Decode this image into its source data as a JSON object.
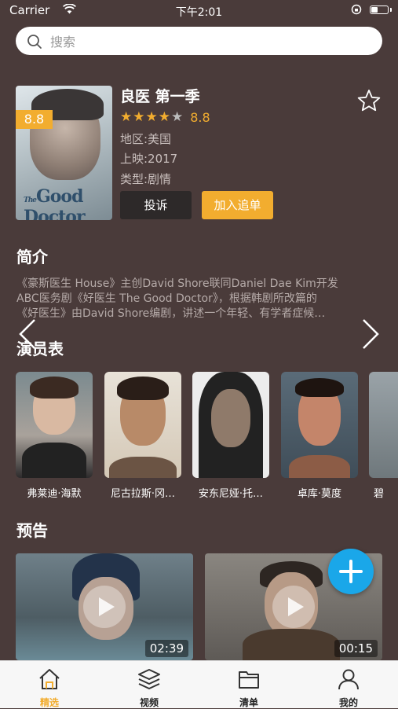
{
  "status_bar": {
    "carrier": "Carrier",
    "time": "下午2:01"
  },
  "search": {
    "placeholder": "搜索"
  },
  "show": {
    "title": "良医 第一季",
    "score": "8.8",
    "stars": 4.5,
    "region": "地区:美国",
    "release": "上映:2017",
    "genre": "类型:剧情",
    "poster_title": "Good Doctor",
    "poster_prefix": "The",
    "report_label": "投诉",
    "follow_label": "加入追单"
  },
  "colors": {
    "accent": "#f2ad2f",
    "background": "#4a3b3a",
    "fab": "#1aa7e9"
  },
  "intro": {
    "heading": "简介",
    "lines": [
      "《豪斯医生 House》主创David Shore联同Daniel Dae Kim开发",
      "ABC医务剧《好医生 The Good Doctor》，根据韩剧所改篇的",
      "《好医生》由David Shore编剧，讲述一个年轻、有学者症候…"
    ]
  },
  "cast": {
    "heading": "演员表",
    "actors": [
      {
        "name": "弗莱迪·海默"
      },
      {
        "name": "尼古拉斯·冈…"
      },
      {
        "name": "安东尼娅·托…"
      },
      {
        "name": "卓库·莫度"
      },
      {
        "name": "碧"
      }
    ]
  },
  "trailers": {
    "heading": "预告",
    "items": [
      {
        "duration": "02:39"
      },
      {
        "duration": "00:15"
      }
    ]
  },
  "tabbar": {
    "items": [
      {
        "label": "精选",
        "icon": "home-icon",
        "active": true
      },
      {
        "label": "视频",
        "icon": "layers-icon",
        "active": false
      },
      {
        "label": "清单",
        "icon": "folder-icon",
        "active": false
      },
      {
        "label": "我的",
        "icon": "user-icon",
        "active": false
      }
    ]
  }
}
